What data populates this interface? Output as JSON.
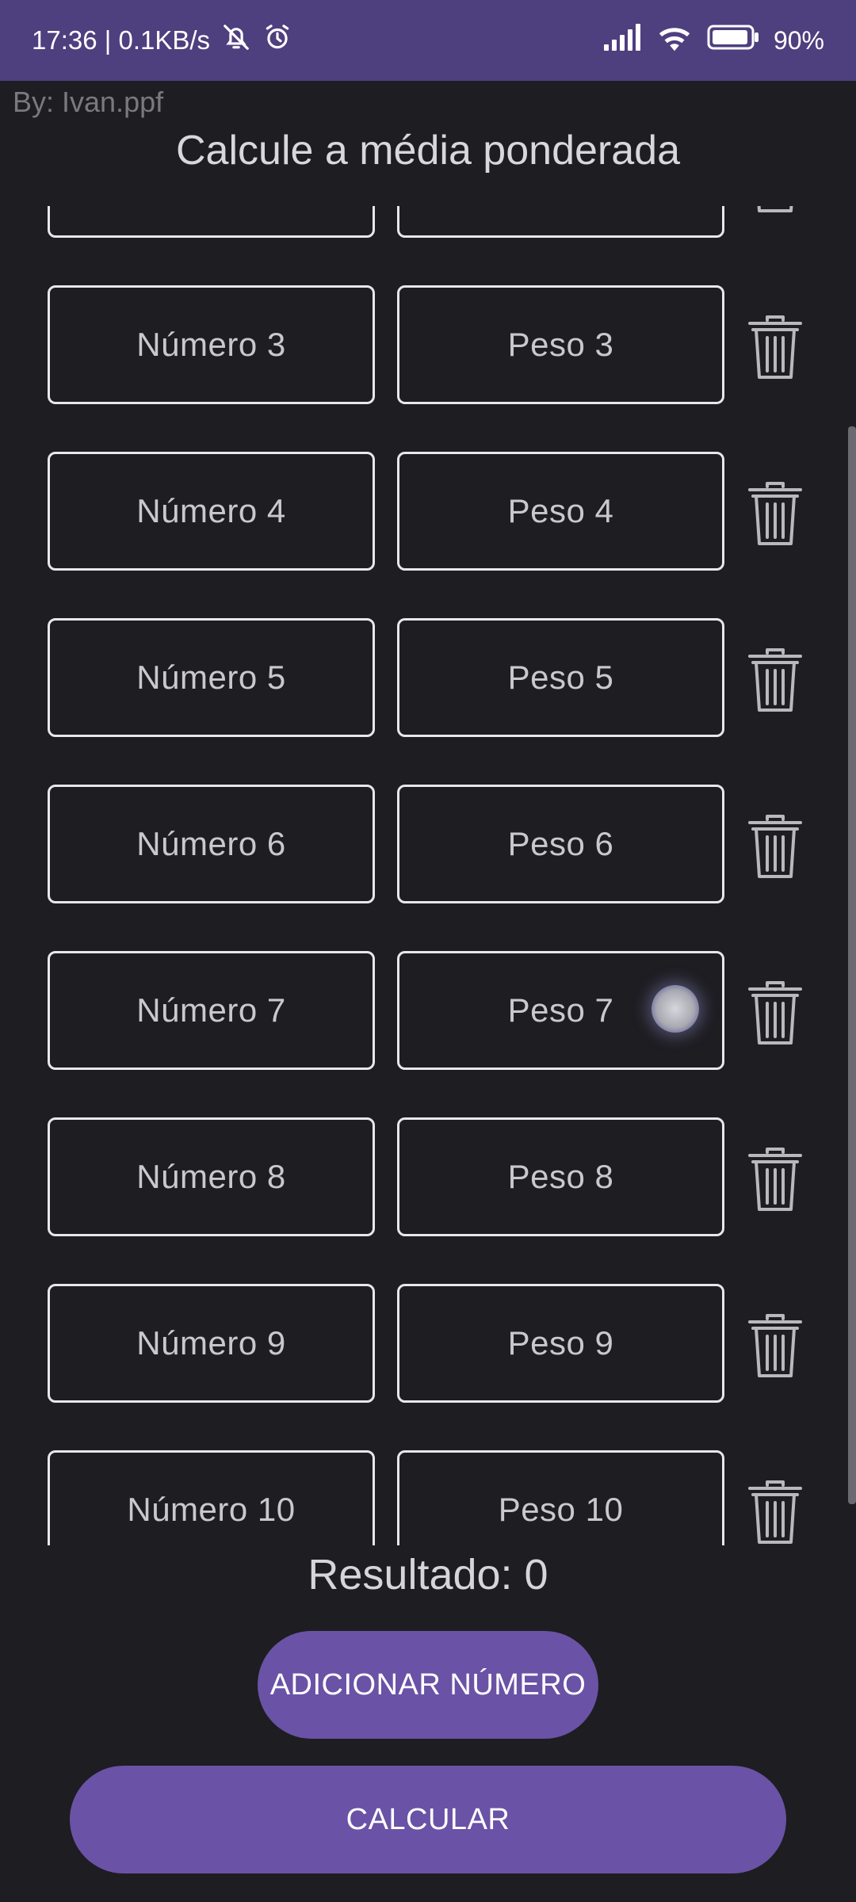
{
  "status_bar": {
    "time": "17:36 | 0.1KB/s",
    "battery_percent": "90%",
    "icons": [
      "bell-off-icon",
      "alarm-icon",
      "signal-icon",
      "wifi-icon",
      "battery-icon"
    ]
  },
  "header": {
    "credit": "By: Ivan.ppf",
    "title": "Calcule a média ponderada"
  },
  "rows": [
    {
      "numero": "",
      "peso": ""
    },
    {
      "numero": "Número 3",
      "peso": "Peso 3"
    },
    {
      "numero": "Número 4",
      "peso": "Peso 4"
    },
    {
      "numero": "Número 5",
      "peso": "Peso 5"
    },
    {
      "numero": "Número 6",
      "peso": "Peso 6"
    },
    {
      "numero": "Número 7",
      "peso": "Peso 7"
    },
    {
      "numero": "Número 8",
      "peso": "Peso 8"
    },
    {
      "numero": "Número 9",
      "peso": "Peso 9"
    },
    {
      "numero": "Número 10",
      "peso": "Peso 10"
    }
  ],
  "result": {
    "label": "Resultado: 0"
  },
  "buttons": {
    "add": "ADICIONAR NÚMERO",
    "calculate": "CALCULAR"
  },
  "colors": {
    "status_bar": "#4e3f7e",
    "background": "#1e1d22",
    "button": "#6a52a6"
  }
}
